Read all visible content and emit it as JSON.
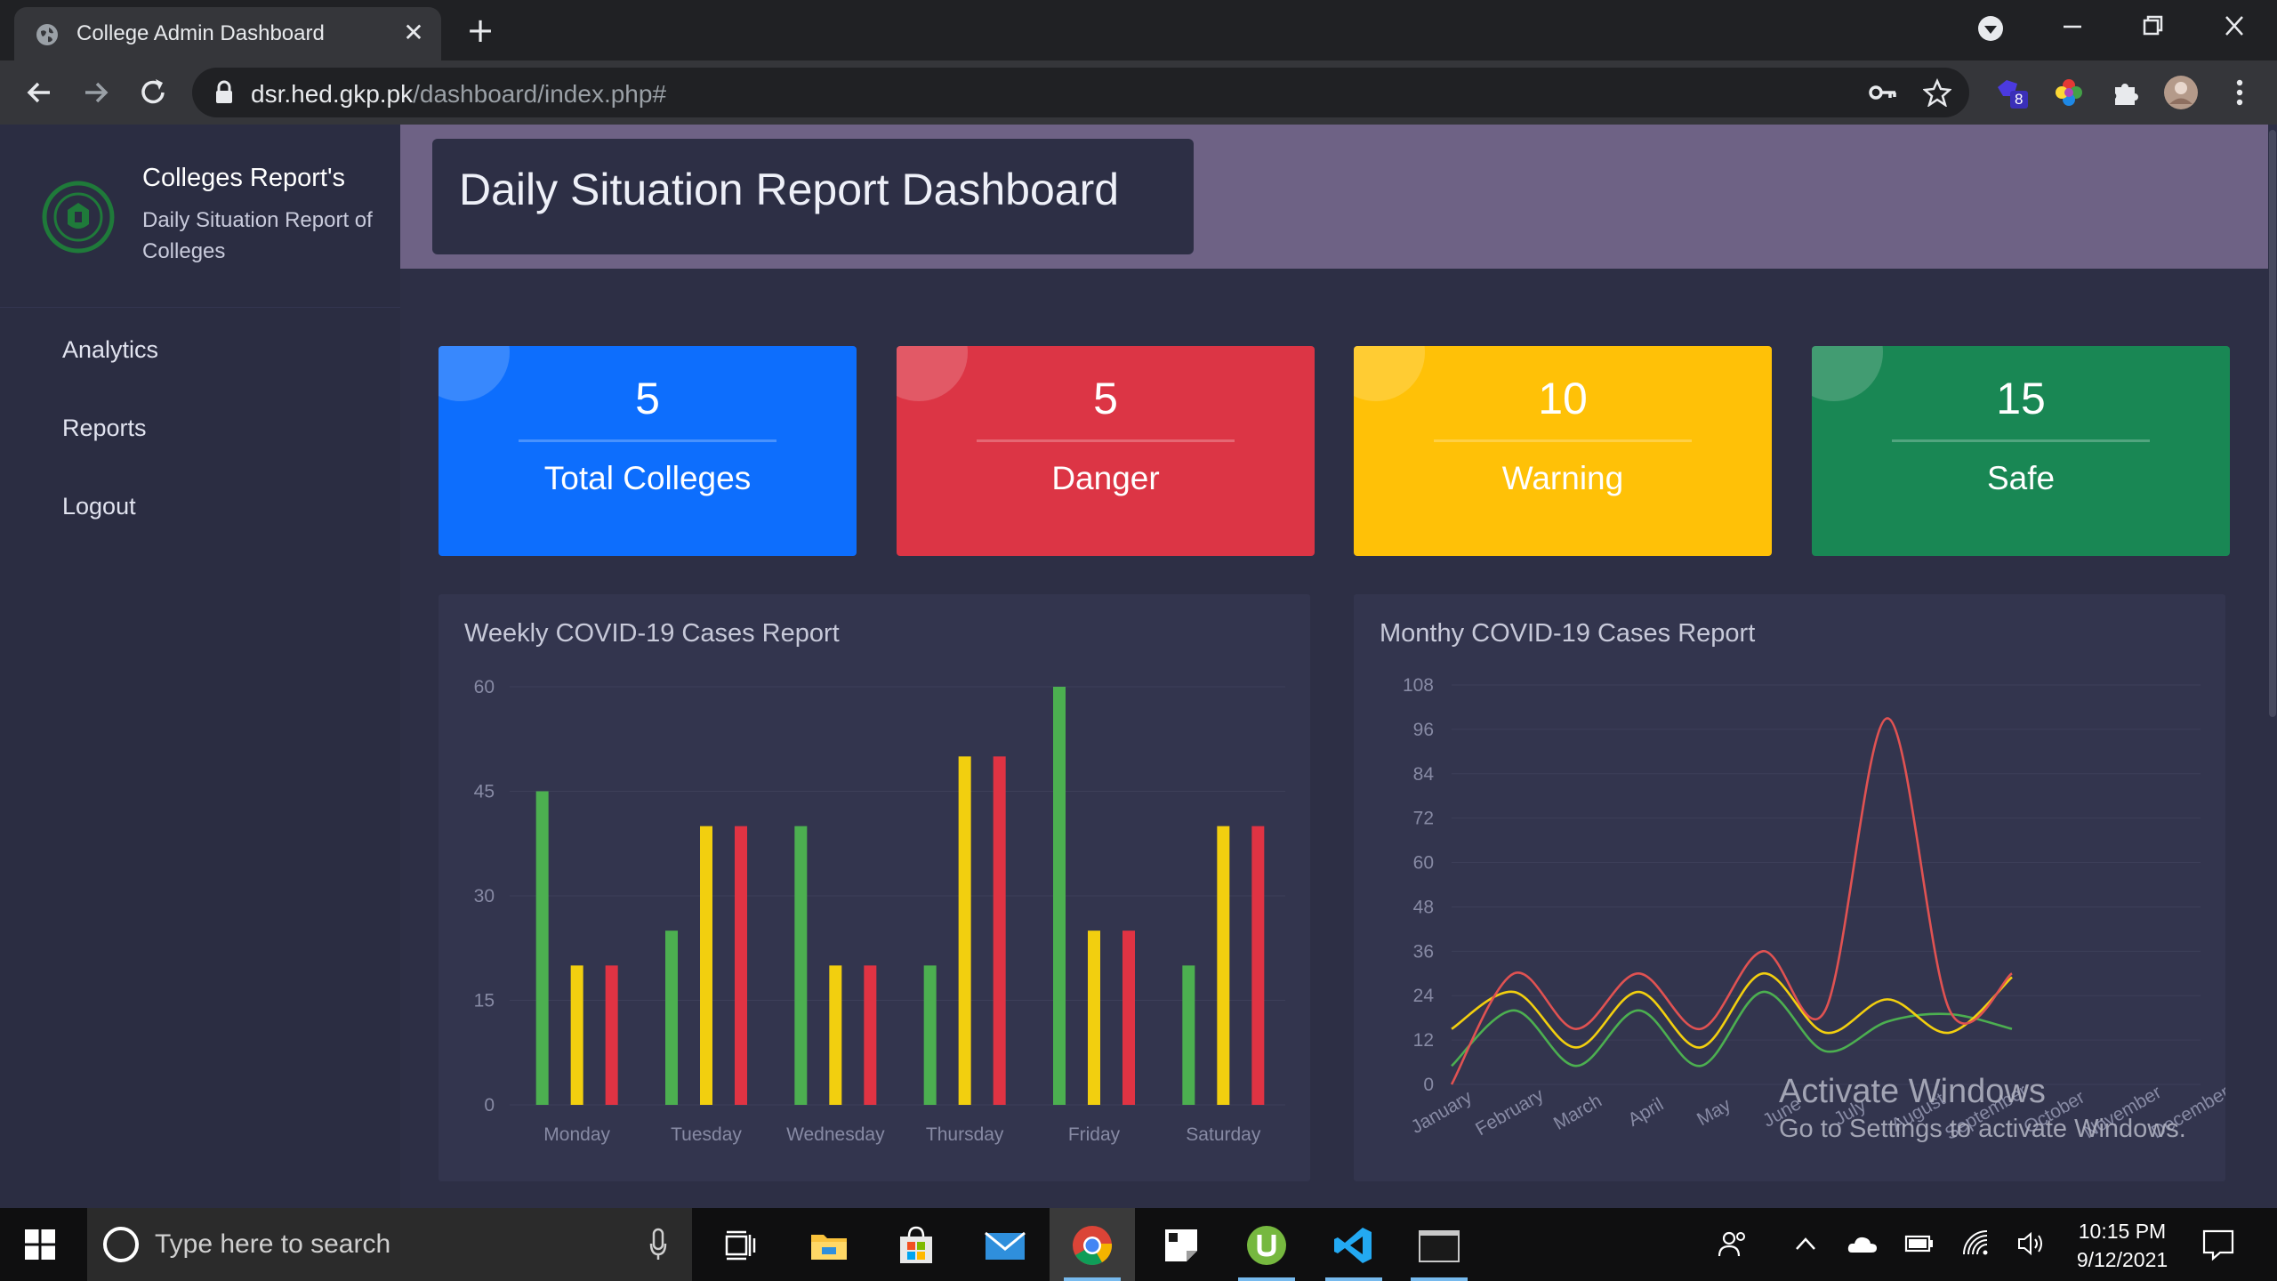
{
  "browser": {
    "tab_title": "College Admin Dashboard",
    "url_host": "dsr.hed.gkp.pk",
    "url_path": "/dashboard/index.php#",
    "extension_badge": "8"
  },
  "sidebar": {
    "brand_title": "Colleges Report's",
    "brand_subtitle": "Daily Situation Report of Colleges",
    "items": [
      {
        "label": "Analytics"
      },
      {
        "label": "Reports"
      },
      {
        "label": "Logout"
      }
    ]
  },
  "header": {
    "title": "Daily Situation Report Dashboard"
  },
  "cards": [
    {
      "value": "5",
      "label": "Total Colleges",
      "color": "#0d6efd"
    },
    {
      "value": "5",
      "label": "Danger",
      "color": "#dc3545"
    },
    {
      "value": "10",
      "label": "Warning",
      "color": "#ffc107"
    },
    {
      "value": "15",
      "label": "Safe",
      "color": "#198754"
    }
  ],
  "chart_data": [
    {
      "type": "bar",
      "title": "Weekly COVID-19 Cases Report",
      "categories": [
        "Monday",
        "Tuesday",
        "Wednesday",
        "Thursday",
        "Friday",
        "Saturday"
      ],
      "series": [
        {
          "values": [
            45,
            25,
            40,
            20,
            60,
            20
          ],
          "color": "#4caf50"
        },
        {
          "values": [
            20,
            40,
            20,
            50,
            25,
            40
          ],
          "color": "#f2cf0f"
        },
        {
          "values": [
            20,
            40,
            20,
            50,
            25,
            40
          ],
          "color": "#e03343"
        }
      ],
      "ylim": [
        0,
        60
      ],
      "yticks": [
        0,
        15,
        30,
        45,
        60
      ],
      "grid": true
    },
    {
      "type": "line",
      "title": "Monthy COVID-19 Cases Report",
      "categories": [
        "January",
        "February",
        "March",
        "April",
        "May",
        "June",
        "July",
        "August",
        "September",
        "October",
        "November",
        "December"
      ],
      "series": [
        {
          "values": [
            0,
            30,
            15,
            30,
            15,
            36,
            20,
            99,
            20,
            30
          ],
          "color": "#e05252"
        },
        {
          "values": [
            15,
            25,
            10,
            25,
            10,
            30,
            14,
            23,
            14,
            29
          ],
          "color": "#f2cf0f"
        },
        {
          "values": [
            5,
            20,
            5,
            20,
            5,
            25,
            9,
            17,
            19,
            15
          ],
          "color": "#4caf50"
        }
      ],
      "ylim": [
        0,
        108
      ],
      "yticks": [
        0,
        12,
        24,
        36,
        48,
        60,
        72,
        84,
        96,
        108
      ],
      "grid": true
    }
  ],
  "watermark": {
    "line1": "Activate Windows",
    "line2": "Go to Settings to activate Windows."
  },
  "taskbar": {
    "search_placeholder": "Type here to search",
    "time": "10:15 PM",
    "date": "9/12/2021"
  }
}
